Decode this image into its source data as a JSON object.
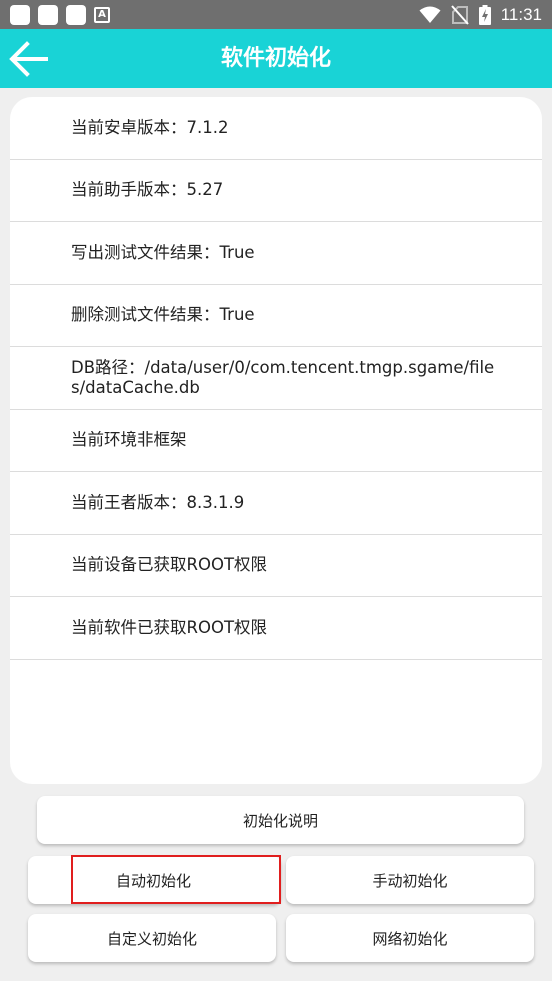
{
  "status_bar": {
    "time": "11:31",
    "notification_icons": [
      "app-square-icon",
      "app-square-icon",
      "app-square-icon",
      "a-icon"
    ],
    "system_icons": [
      "wifi-icon",
      "no-sim-icon",
      "battery-charging-icon"
    ]
  },
  "header": {
    "title": "软件初始化",
    "background_color": "#19d3d6"
  },
  "info": {
    "items": [
      {
        "text": "当前安卓版本：7.1.2"
      },
      {
        "text": "当前助手版本：5.27"
      },
      {
        "text": "写出测试文件结果：True"
      },
      {
        "text": "删除测试文件结果：True"
      },
      {
        "text": "DB路径：/data/user/0/com.tencent.tmgp.sgame/files/dataCache.db"
      },
      {
        "text": "当前环境非框架"
      },
      {
        "text": "当前王者版本：8.3.1.9"
      },
      {
        "text": "当前设备已获取ROOT权限"
      },
      {
        "text": "当前软件已获取ROOT权限"
      }
    ]
  },
  "actions": {
    "explain_label": "初始化说明",
    "auto_label": "自动初始化",
    "manual_label": "手动初始化",
    "custom_label": "自定义初始化",
    "network_label": "网络初始化"
  },
  "colors": {
    "accent": "#19d3d6",
    "highlight": "#e01e1e"
  }
}
